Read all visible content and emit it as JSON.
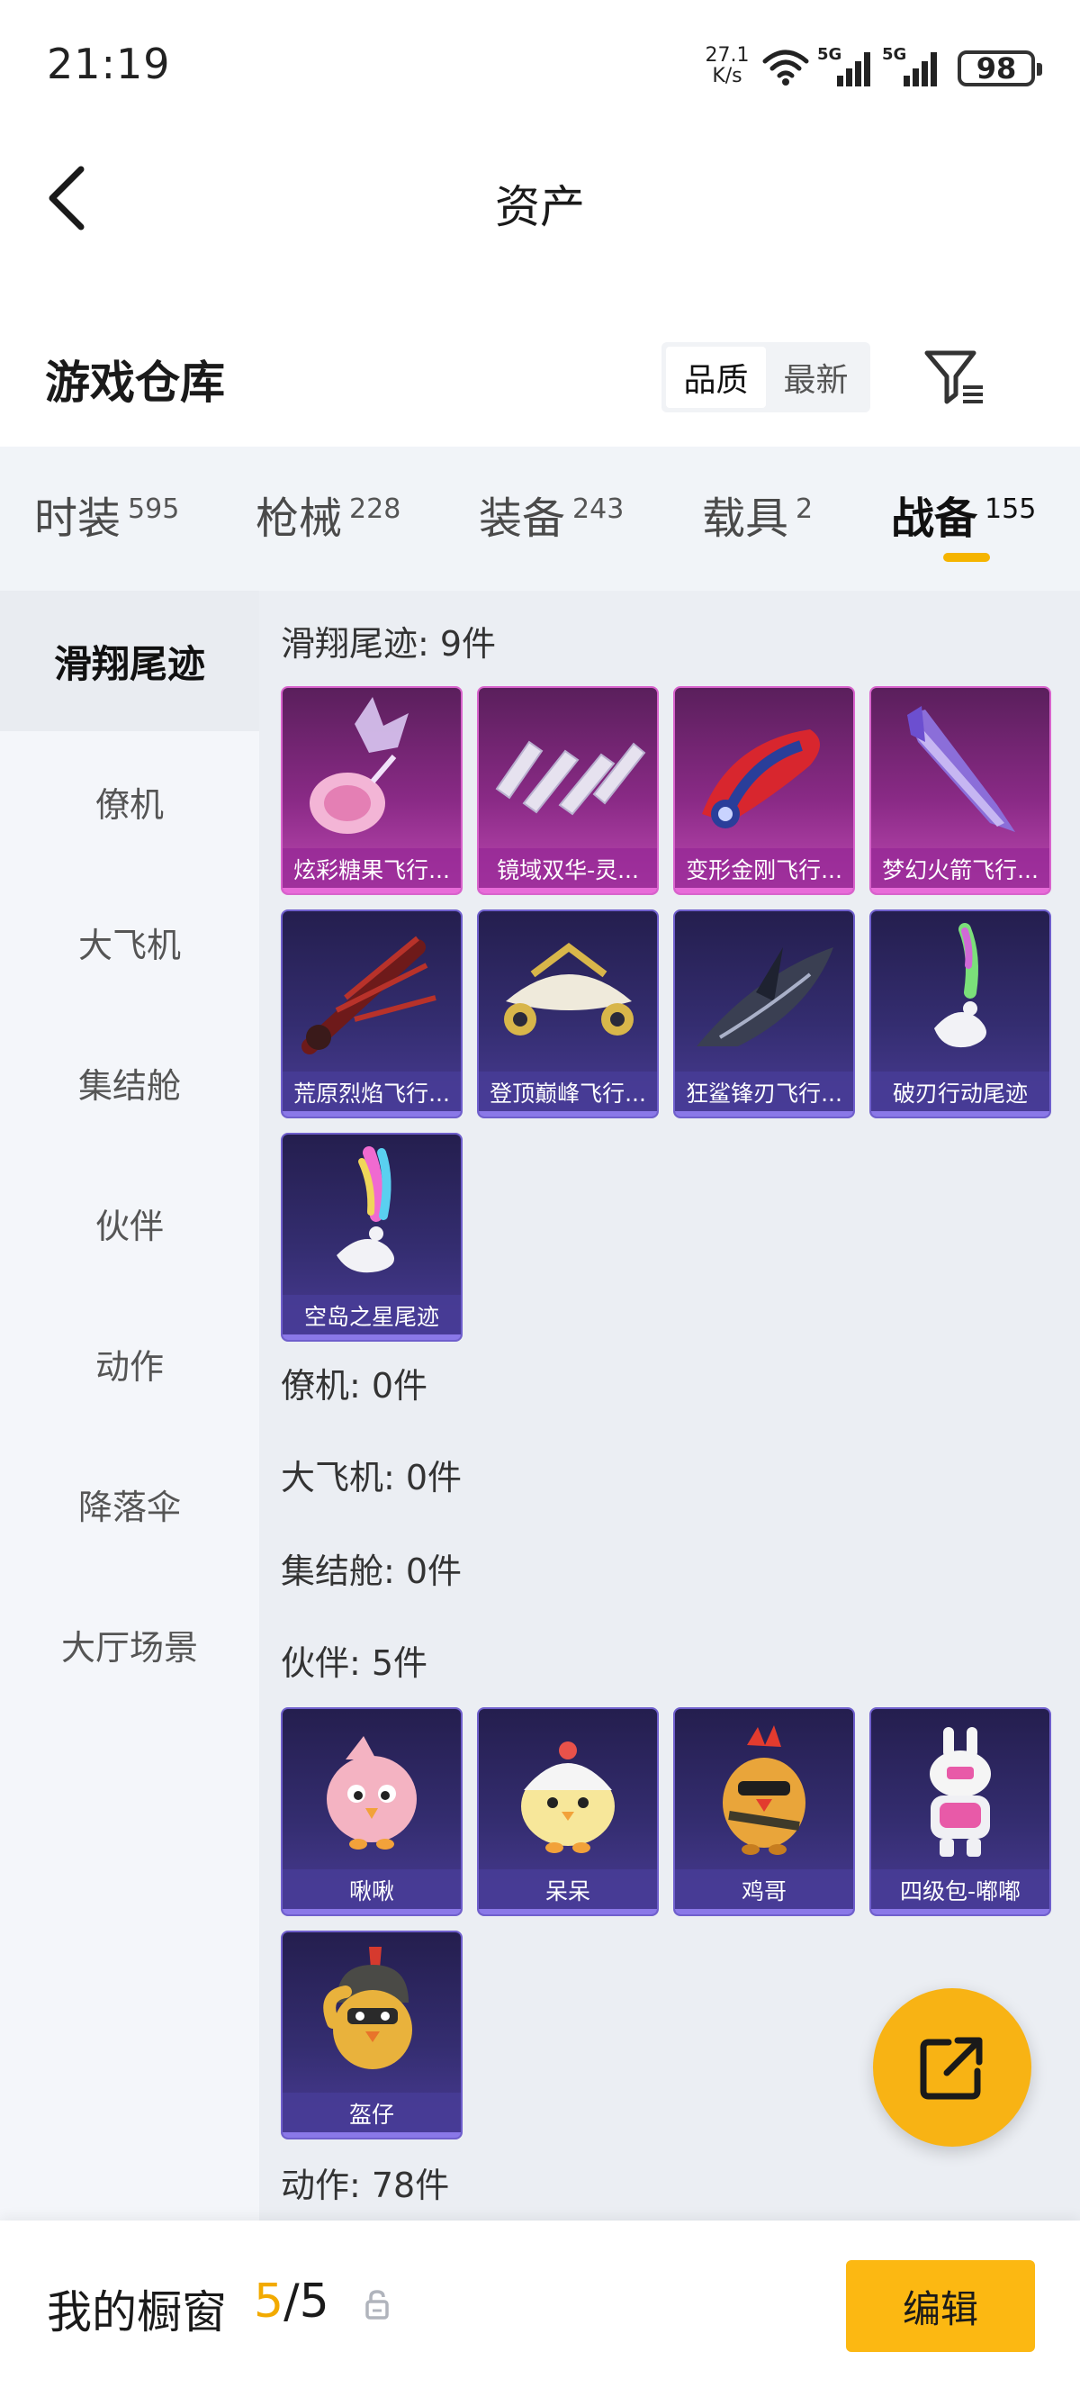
{
  "status_bar": {
    "time": "21:19",
    "net_speed_value": "27.1",
    "net_speed_unit": "K/s",
    "signal_1": "5G",
    "signal_2": "5G",
    "battery": "98"
  },
  "header": {
    "title": "资产",
    "back_icon": "chevron-left-icon"
  },
  "warehouse": {
    "title": "游戏仓库",
    "sort_options": [
      "品质",
      "最新"
    ],
    "active_sort": "品质",
    "filter_icon": "filter-icon"
  },
  "tabs": [
    {
      "label": "时装",
      "count": "595"
    },
    {
      "label": "枪械",
      "count": "228"
    },
    {
      "label": "装备",
      "count": "243"
    },
    {
      "label": "载具",
      "count": "2"
    },
    {
      "label": "战备",
      "count": "155",
      "active": true
    }
  ],
  "accent_color": "#f5b400",
  "sidebar": {
    "items": [
      "滑翔尾迹",
      "僚机",
      "大飞机",
      "集结舱",
      "伙伴",
      "动作",
      "降落伞",
      "大厅场景"
    ],
    "active": "滑翔尾迹"
  },
  "sections": {
    "glide": {
      "title": "滑翔尾迹: 9件",
      "items": [
        {
          "name": "炫彩糖果飞行...",
          "rarity": "pink"
        },
        {
          "name": "镜域双华-灵...",
          "rarity": "pink"
        },
        {
          "name": "变形金刚飞行...",
          "rarity": "pink"
        },
        {
          "name": "梦幻火箭飞行...",
          "rarity": "pink"
        },
        {
          "name": "荒原烈焰飞行...",
          "rarity": "purple"
        },
        {
          "name": "登顶巅峰飞行...",
          "rarity": "purple"
        },
        {
          "name": "狂鲨锋刃飞行...",
          "rarity": "purple"
        },
        {
          "name": "破刃行动尾迹",
          "rarity": "purple"
        },
        {
          "name": "空岛之星尾迹",
          "rarity": "purple"
        }
      ]
    },
    "wingman": {
      "title": "僚机: 0件"
    },
    "big_plane": {
      "title": "大飞机: 0件"
    },
    "pod": {
      "title": "集结舱: 0件"
    },
    "companion": {
      "title": "伙伴: 5件",
      "items": [
        {
          "name": "啾啾",
          "rarity": "purple"
        },
        {
          "name": "呆呆",
          "rarity": "purple"
        },
        {
          "name": "鸡哥",
          "rarity": "purple"
        },
        {
          "name": "四级包-嘟嘟",
          "rarity": "purple"
        },
        {
          "name": "盔仔",
          "rarity": "purple"
        }
      ]
    },
    "emote": {
      "title": "动作: 78件"
    }
  },
  "fab_icon": "share-icon",
  "bottom_bar": {
    "label": "我的橱窗",
    "count_current": "5",
    "count_sep": "/",
    "count_max": "5",
    "lock_icon": "lock-icon",
    "edit_label": "编辑"
  }
}
